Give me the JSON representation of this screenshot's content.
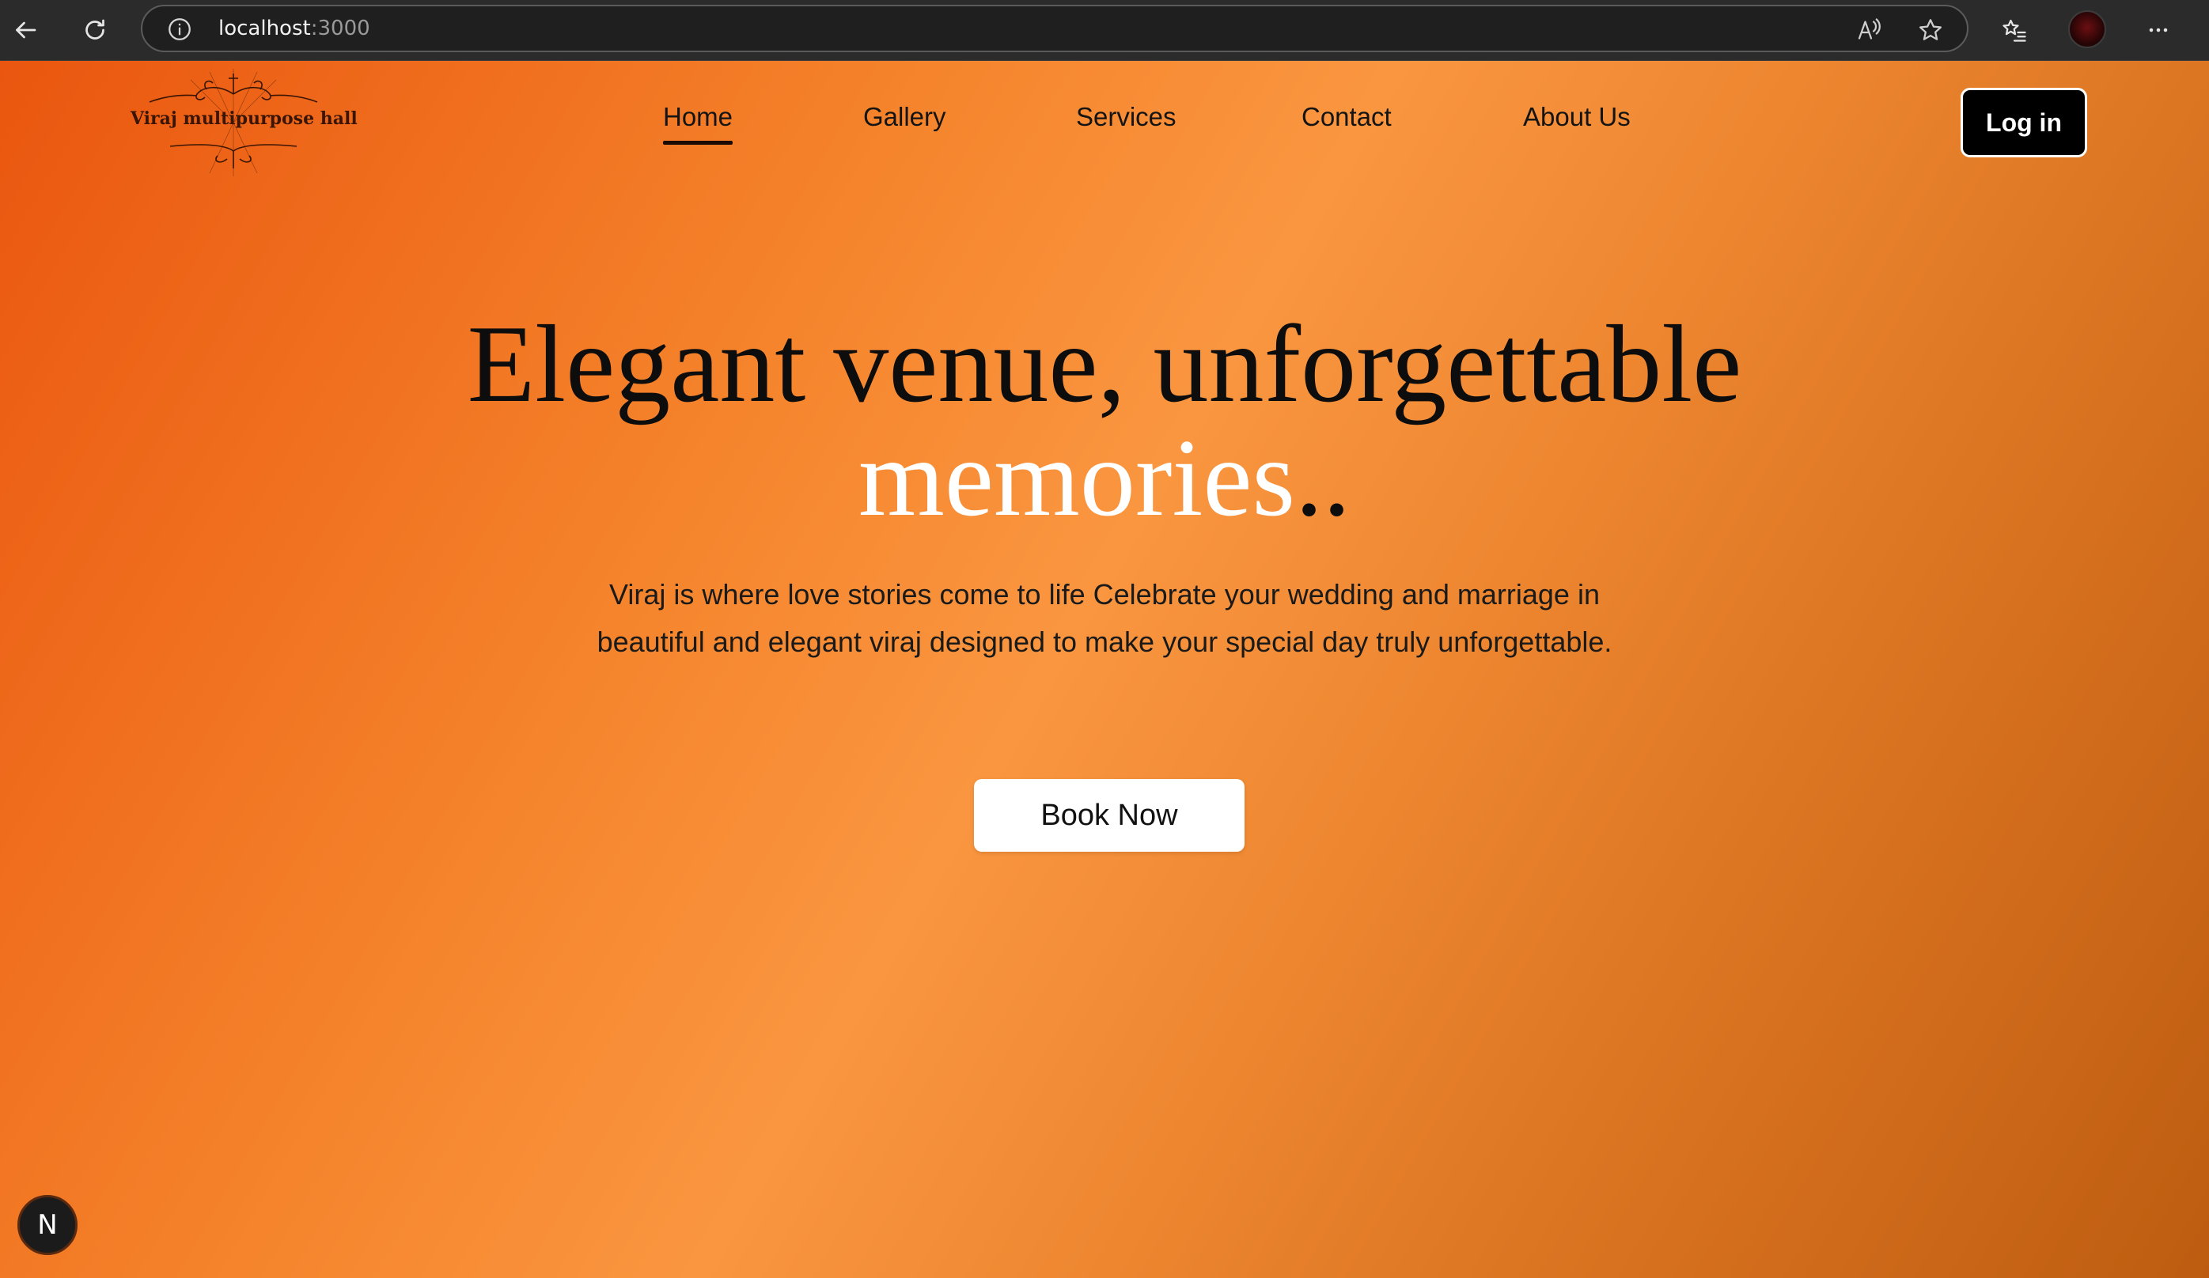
{
  "browser": {
    "url_host": "localhost",
    "url_port": ":3000",
    "icons": {
      "back": "back-arrow-icon",
      "reload": "reload-icon",
      "site_info": "info-icon",
      "read_aloud": "read-aloud-icon",
      "favorite": "star-icon",
      "favorites": "favorites-list-icon",
      "profile": "avatar",
      "menu": "more-icon"
    }
  },
  "site": {
    "logo_text": "Viraj multipurpose hall",
    "nav": [
      {
        "label": "Home",
        "active": true
      },
      {
        "label": "Gallery",
        "active": false
      },
      {
        "label": "Services",
        "active": false
      },
      {
        "label": "Contact",
        "active": false
      },
      {
        "label": "About Us",
        "active": false
      }
    ],
    "login_label": "Log in"
  },
  "hero": {
    "title_line1": "Elegant venue, unforgettable",
    "title_highlight": "memories",
    "title_end": "..",
    "description": "Viraj is where love stories come to life Celebrate your wedding and marriage in beautiful and elegant viraj designed to make your special day truly unforgettable.",
    "cta_label": "Book Now"
  },
  "dev_badge": {
    "label": "N"
  },
  "colors": {
    "gradient_start": "#ea560f",
    "gradient_mid": "#fa9640",
    "gradient_end": "#bd5c10",
    "title_highlight": "#ffffff",
    "login_bg": "#000000",
    "cta_bg": "#ffffff"
  }
}
